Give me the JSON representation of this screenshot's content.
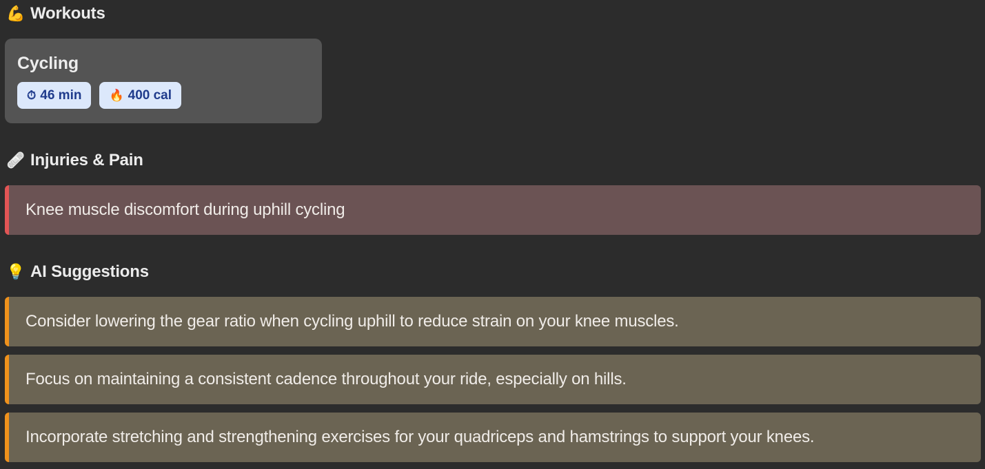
{
  "sections": {
    "workouts": {
      "icon": "flexed-biceps-icon",
      "emoji": "💪",
      "title": "Workouts"
    },
    "injuries": {
      "icon": "adhesive-bandage-icon",
      "emoji": "🩹",
      "title": "Injuries & Pain"
    },
    "ai": {
      "icon": "light-bulb-icon",
      "emoji": "💡",
      "title": "AI Suggestions"
    }
  },
  "workouts": [
    {
      "name": "Cycling",
      "duration": {
        "icon": "stopwatch-icon",
        "emoji": "⏱",
        "label": "46 min"
      },
      "calories": {
        "icon": "fire-icon",
        "emoji": "🔥",
        "label": "400 cal"
      }
    }
  ],
  "injuries": [
    "Knee muscle discomfort during uphill cycling"
  ],
  "suggestions": [
    "Consider lowering the gear ratio when cycling uphill to reduce strain on your knee muscles.",
    "Focus on maintaining a consistent cadence throughout your ride, especially on hills.",
    "Incorporate stretching and strengthening exercises for your quadriceps and hamstrings to support your knees."
  ],
  "colors": {
    "background": "#2c2c2c",
    "card": "#545454",
    "badge_bg": "#dce8fb",
    "badge_text": "#1f3b8c",
    "injury_bg": "#6b5354",
    "injury_accent": "#e25555",
    "suggestion_bg": "#6b6453",
    "suggestion_accent": "#f0921c"
  }
}
